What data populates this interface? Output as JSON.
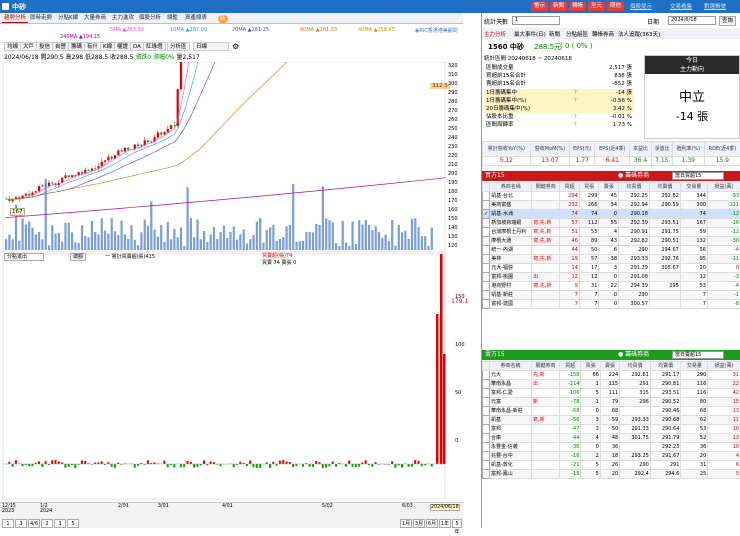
{
  "window": {
    "title": "中砂",
    "buttons": [
      "警示",
      "新聞",
      "轉帳",
      "至元",
      "問他"
    ],
    "links": [
      "個股提示",
      "交易看盤",
      "對選帳號"
    ]
  },
  "left_tabs": [
    "趨勢分析",
    "即時走勢",
    "分點K線",
    "大量券商",
    "主力進攻",
    "個股分析",
    "總監",
    "資產總表",
    "新"
  ],
  "ma_labels": [
    {
      "t": "5MA ▲293.90",
      "c": "#ff4fd0"
    },
    {
      "t": "10MA ▲287.00",
      "c": "#2aa0e0"
    },
    {
      "t": "20MA ▲281.25",
      "c": "#4a4adb"
    },
    {
      "t": "60MA ▲261.33",
      "c": "#e07000"
    },
    {
      "t": "40MA ▲258.45",
      "c": "#c8a000"
    },
    {
      "t": "240MA ▲194.15",
      "c": "#b000b0"
    }
  ],
  "ma_note": "◉RIC香港港美顧問",
  "toolbar": [
    "均線",
    "大戶",
    "投信",
    "自營",
    "籌碼",
    "有什",
    "K線",
    "權證",
    "DA",
    "紅綠燈",
    "分析區",
    "日線"
  ],
  "toolbar_extra": "⚙",
  "info": {
    "date": "2024/06/18",
    "open_label": "開",
    "open": "290.5",
    "high_label": "高",
    "high": "298",
    "low_label": "低",
    "low": "288.5",
    "close_label": "收",
    "close": "288.5",
    "change_label": "漲跌",
    "change": "0",
    "pct_label": "漲幅",
    "pct": "0%",
    "vol_label": "量",
    "vol": "2,517"
  },
  "price_axis": [
    "320",
    "310",
    "300",
    "290",
    "280",
    "270",
    "260",
    "250",
    "240",
    "230",
    "220",
    "210",
    "200",
    "190",
    "180",
    "170",
    "160",
    "150",
    "140",
    "130",
    "120"
  ],
  "price_tag": "312.5",
  "low_tag": "167",
  "sub_panel": {
    "select": "分點進出",
    "btn": "總額",
    "legend": "一 累計買賣超(張)415",
    "buy": "買賣超(張)74",
    "sell": "買賣 74 賣張 0",
    "right_val": "179.1"
  },
  "sub_axis": [
    "150",
    "100",
    "50",
    "0"
  ],
  "x_axis": [
    "12/15\n2023",
    "1/2\n2024",
    "2/01",
    "3/01",
    "4/01",
    "5/02",
    "6/03",
    "2024/06/18"
  ],
  "bottom_btns": [
    "1",
    "3",
    "4/6",
    "2",
    "3",
    "5"
  ],
  "bottom_ranges": [
    "1月",
    "3月",
    "6月",
    "1年",
    "5年"
  ],
  "right": {
    "stat_label": "統計天數",
    "stat_days": "1",
    "date_btn": "日期",
    "date": "2024/6/18",
    "query": "查詢",
    "tabs": [
      "主力分析",
      "最大事件(日)",
      "新聞",
      "分點組區",
      "轉帳券商",
      "法人追蹤(363天)"
    ],
    "stock": "1560 中砂",
    "price": "288.5元",
    "chg": "( 0 ( 0% )",
    "period_label": "統計區間",
    "period": "20240618 ~ 20240618",
    "stats": [
      [
        "區間成交量",
        "",
        "2,517 張"
      ],
      [
        "買超前15名合計",
        "",
        "838 張"
      ],
      [
        "賣超前15名合計",
        "",
        "-852 張"
      ],
      [
        "1日籌碼集中",
        "?",
        "-14 張"
      ],
      [
        "1日籌碼集中(%)",
        "?",
        "-0.56 %"
      ],
      [
        "20日籌碼集中(%)",
        "",
        "3.42 %"
      ],
      [
        "佔股本比重",
        "?",
        "-0.01 %"
      ],
      [
        "區間周轉率",
        "?",
        "1.73 %"
      ]
    ],
    "today_h1": "今日",
    "today_h2": "主力動向",
    "today_main": "中立",
    "today_val": "-14 張",
    "fund_heads": [
      "累計營收YoY(%)",
      "營收MoM(%)",
      "EPS(元)",
      "EPS(近4季)",
      "本益比",
      "淨值比",
      "殖利率(%)",
      "ROE(近4季)"
    ],
    "fund_vals": [
      "5.12",
      "13.07",
      "1.77",
      "6.41",
      "36.4",
      "7.15",
      "1.39",
      "15.9"
    ],
    "buy_title": "買方15",
    "buy_tag": "● 籌碼券商",
    "buy_sel": "當日買超15",
    "cols": [
      "",
      "券商名稱",
      "關鍵券商",
      "買超",
      "買張",
      "賣張",
      "均買價",
      "均賣價",
      "交易量",
      "損益(萬)"
    ],
    "buy_rows": [
      [
        "",
        "凱基-台北",
        "",
        "294",
        "299",
        "45",
        "292.25",
        "292.82",
        "344",
        "-93"
      ],
      [
        "",
        "美商富盛",
        "",
        "232",
        "266",
        "34",
        "292.94",
        "290.59",
        "300",
        "-111"
      ],
      [
        "✓",
        "凱基-水湳",
        "",
        "74",
        "74",
        "0",
        "290.18",
        "",
        "74",
        "-12"
      ],
      [
        "",
        "新加坡商瑞銀",
        "寫,先,新",
        "57",
        "112",
        "55",
        "292.39",
        "293.51",
        "167",
        "-16"
      ],
      [
        "",
        "台灣摩根士丹利",
        "寫,先,新",
        "51",
        "55",
        "4",
        "290.91",
        "291.75",
        "59",
        "-12"
      ],
      [
        "",
        "摩根大通",
        "寫,先,新",
        "46",
        "89",
        "43",
        "292.82",
        "290.51",
        "132",
        "-30"
      ],
      [
        "",
        "統一-內湖",
        "",
        "44",
        "50",
        "6",
        "290",
        "294.67",
        "56",
        "-4"
      ],
      [
        "",
        "美林",
        "寫,先,新",
        "19",
        "57",
        "38",
        "293.33",
        "292.76",
        "95",
        "-11"
      ],
      [
        "",
        "元大-福營",
        "",
        "14",
        "17",
        "3",
        "291.29",
        "305.67",
        "20",
        "0"
      ],
      [
        "",
        "富邦-桃園",
        "出",
        "12",
        "12",
        "0",
        "291.08",
        "",
        "12",
        "-3"
      ],
      [
        "",
        "港商野村",
        "寫,先,新",
        "9",
        "31",
        "22",
        "294.39",
        "295",
        "53",
        "-4"
      ],
      [
        "",
        "凱基-新莊",
        "",
        "7",
        "7",
        "0",
        "290",
        "",
        "7",
        "-1"
      ],
      [
        "",
        "富邦-建國",
        "",
        "7",
        "7",
        "0",
        "300.57",
        "",
        "7",
        "-8"
      ]
    ],
    "sell_title": "賣方15",
    "sell_tag": "● 籌碼券商",
    "sell_sel": "當日賣超15",
    "sell_rows": [
      [
        "",
        "元大",
        "先,新",
        "-158",
        "66",
        "224",
        "292.61",
        "291.17",
        "290",
        "31"
      ],
      [
        "",
        "華南永昌",
        "出",
        "-114",
        "1",
        "115",
        "291",
        "290.81",
        "116",
        "22"
      ],
      [
        "",
        "富邦-仁愛",
        "",
        "-106",
        "5",
        "111",
        "315",
        "293.51",
        "116",
        "42"
      ],
      [
        "",
        "元富",
        "新",
        "-78",
        "1",
        "79",
        "296",
        "290.52",
        "80",
        "15"
      ],
      [
        "",
        "華南永昌-新莊",
        "",
        "-68",
        "0",
        "68",
        "",
        "290.46",
        "68",
        "13"
      ],
      [
        "",
        "凱基",
        "寫,新",
        "-56",
        "3",
        "59",
        "293.33",
        "290.68",
        "62",
        "11"
      ],
      [
        "",
        "富邦",
        "",
        "-47",
        "3",
        "50",
        "291.33",
        "290.64",
        "53",
        "10"
      ],
      [
        "",
        "合庫",
        "",
        "-44",
        "4",
        "48",
        "301.75",
        "291.79",
        "52",
        "13"
      ],
      [
        "",
        "永豐金-信義",
        "",
        "-36",
        "0",
        "36",
        "",
        "292.23",
        "36",
        "10"
      ],
      [
        "",
        "兆豐-台中",
        "",
        "-16",
        "2",
        "18",
        "293.25",
        "291.67",
        "20",
        "4"
      ],
      [
        "",
        "凱基-敦化",
        "",
        "-21",
        "5",
        "26",
        "290",
        "291",
        "31",
        "6"
      ],
      [
        "",
        "富邦-鳳山",
        "",
        "-15",
        "5",
        "20",
        "292.4",
        "294.6",
        "25",
        "5"
      ]
    ]
  },
  "chart_data": {
    "type": "candlestick",
    "ylim": [
      115,
      325
    ],
    "close_last": 288.5
  }
}
